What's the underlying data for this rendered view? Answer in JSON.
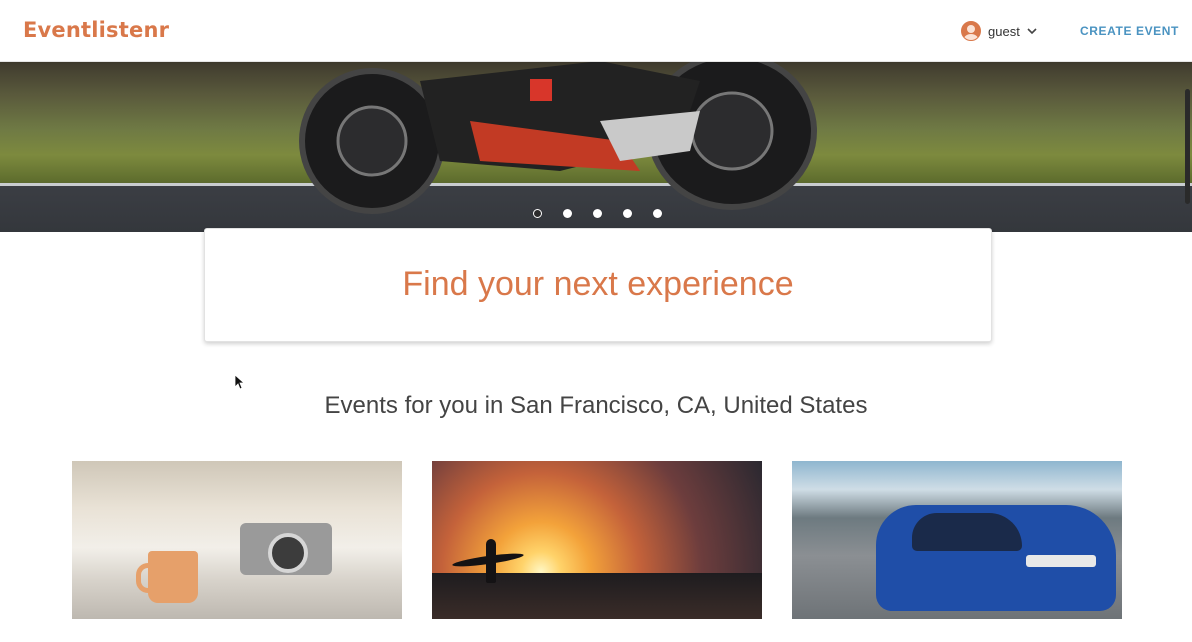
{
  "header": {
    "logo": "Eventlistenr",
    "user_name": "guest",
    "create_event_label": "CREATE EVENT"
  },
  "hero": {
    "slides_count": 5,
    "active_slide": 1
  },
  "search": {
    "prompt": "Find your next experience"
  },
  "section": {
    "title": "Events for you in San Francisco, CA, United States"
  },
  "colors": {
    "brand": "#d9784a",
    "link": "#4a93c1"
  }
}
